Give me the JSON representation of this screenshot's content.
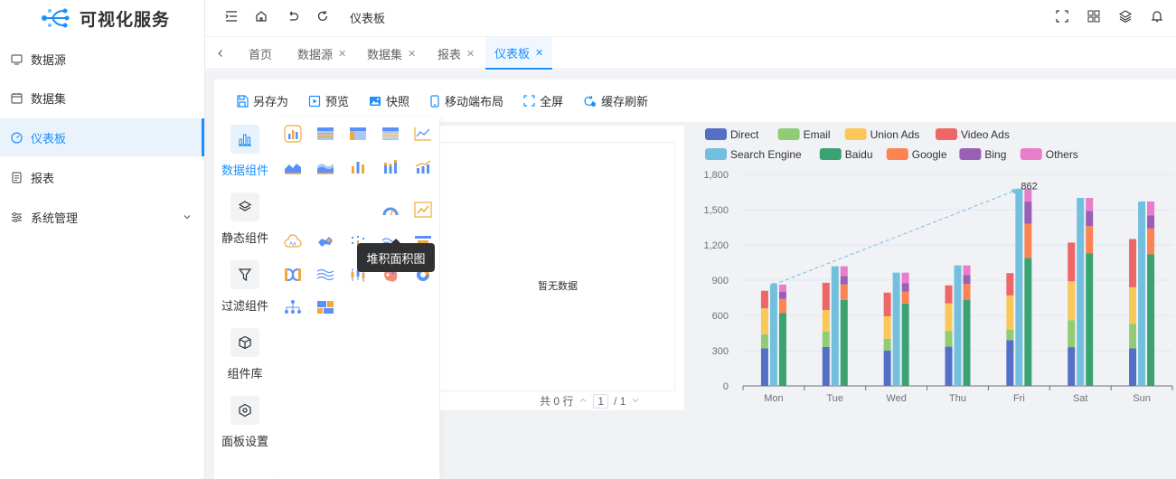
{
  "app": {
    "title": "可视化服务"
  },
  "sidebar": {
    "items": [
      {
        "label": "数据源",
        "icon": "datasource-icon"
      },
      {
        "label": "数据集",
        "icon": "dataset-icon"
      },
      {
        "label": "仪表板",
        "icon": "dashboard-icon",
        "active": true
      },
      {
        "label": "报表",
        "icon": "report-icon"
      },
      {
        "label": "系统管理",
        "icon": "settings-icon"
      }
    ]
  },
  "header": {
    "breadcrumb": "仪表板"
  },
  "tabs": [
    "首页",
    "数据源",
    "数据集",
    "报表",
    "仪表板"
  ],
  "toolbar": {
    "save_as": "另存为",
    "preview": "预览",
    "snapshot": "快照",
    "mobile_layout": "移动端布局",
    "fullscreen": "全屏",
    "cache_refresh": "缓存刷新"
  },
  "categories": [
    "数据组件",
    "静态组件",
    "过滤组件",
    "组件库",
    "面板设置"
  ],
  "tooltip": "堆积面积图",
  "table_widget": {
    "empty_text": "暂无数据",
    "total": "共 0 行",
    "page_current": "1",
    "page_total": "/ 1"
  },
  "colors": {
    "accent": "#1890ff",
    "Direct": "#5470c6",
    "Email": "#91cc75",
    "Union Ads": "#fac858",
    "Video Ads": "#ee6666",
    "Search Engine": "#73c0de",
    "Baidu": "#3ba272",
    "Google": "#fc8452",
    "Bing": "#9a60b4",
    "Others": "#ea7ccc"
  },
  "chart_data": {
    "type": "bar",
    "categories": [
      "Mon",
      "Tue",
      "Wed",
      "Thu",
      "Fri",
      "Sat",
      "Sun"
    ],
    "ylim": [
      0,
      1800
    ],
    "yticks": [
      "0",
      "300",
      "600",
      "900",
      "1,200",
      "1,500",
      "1,800"
    ],
    "annotation": "862",
    "legend": [
      "Direct",
      "Email",
      "Union Ads",
      "Video Ads",
      "Search Engine",
      "Baidu",
      "Google",
      "Bing",
      "Others"
    ],
    "series": [
      {
        "name": "Direct",
        "stack": "ad",
        "values": [
          320,
          332,
          301,
          334,
          390,
          330,
          320
        ]
      },
      {
        "name": "Email",
        "stack": "ad",
        "values": [
          120,
          132,
          101,
          134,
          90,
          230,
          210
        ]
      },
      {
        "name": "Union Ads",
        "stack": "ad",
        "values": [
          220,
          182,
          191,
          234,
          290,
          330,
          310
        ]
      },
      {
        "name": "Video Ads",
        "stack": "ad",
        "values": [
          150,
          232,
          201,
          154,
          190,
          330,
          410
        ]
      },
      {
        "name": "Search Engine",
        "stack": "search",
        "values": [
          862,
          1018,
          964,
          1026,
          1679,
          1600,
          1570
        ]
      },
      {
        "name": "Baidu",
        "stack": "engine",
        "values": [
          620,
          732,
          701,
          734,
          1090,
          1130,
          1120
        ]
      },
      {
        "name": "Google",
        "stack": "engine",
        "values": [
          120,
          132,
          101,
          134,
          290,
          230,
          220
        ]
      },
      {
        "name": "Bing",
        "stack": "engine",
        "values": [
          60,
          72,
          71,
          74,
          190,
          130,
          110
        ]
      },
      {
        "name": "Others",
        "stack": "engine",
        "values": [
          62,
          82,
          91,
          84,
          109,
          110,
          120
        ]
      }
    ]
  }
}
